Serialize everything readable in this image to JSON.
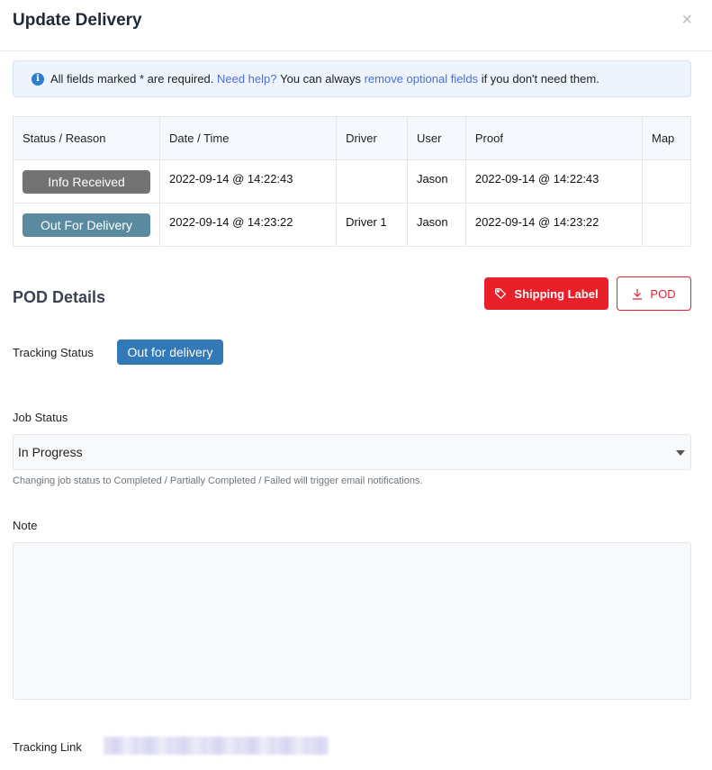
{
  "modal": {
    "title": "Update Delivery",
    "close_label": "×"
  },
  "banner": {
    "icon": "info-icon",
    "text_before": "All fields marked * are required.",
    "help_link": "Need help?",
    "text_middle": "You can always",
    "remove_link": "remove optional fields",
    "text_after": "if you don't need them."
  },
  "history": {
    "columns": [
      "Status / Reason",
      "Date / Time",
      "Driver",
      "User",
      "Proof",
      "Map"
    ],
    "rows": [
      {
        "status": "Info Received",
        "status_color": "#737373",
        "datetime": "2022-09-14 @ 14:22:43",
        "driver": "",
        "user": "Jason",
        "proof": "2022-09-14 @ 14:22:43",
        "map": ""
      },
      {
        "status": "Out For Delivery",
        "status_color": "#5a8aa0",
        "datetime": "2022-09-14 @ 14:23:22",
        "driver": "Driver 1",
        "user": "Jason",
        "proof": "2022-09-14 @ 14:23:22",
        "map": ""
      }
    ]
  },
  "pod": {
    "title": "POD Details",
    "shipping_label_button": "Shipping Label",
    "shipping_icon": "tag-icon",
    "pod_button": "POD",
    "pod_icon": "download-icon",
    "accent_color": "#e8202a"
  },
  "tracking_status": {
    "label": "Tracking Status",
    "value": "Out for delivery",
    "color": "#3378b7"
  },
  "job_status": {
    "label": "Job Status",
    "value": "In Progress",
    "help": "Changing job status to Completed / Partially Completed / Failed will trigger email notifications."
  },
  "note": {
    "label": "Note",
    "value": ""
  },
  "tracking_link": {
    "label": "Tracking Link"
  }
}
